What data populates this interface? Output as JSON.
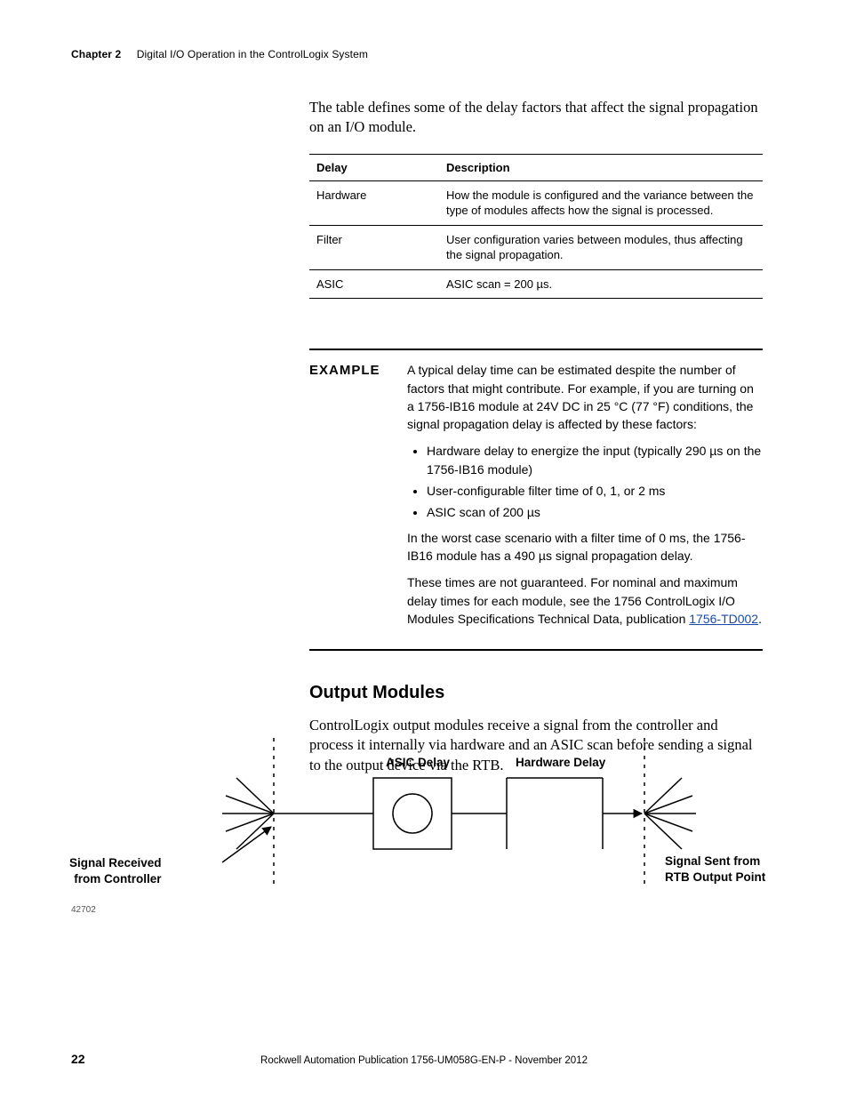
{
  "header": {
    "chapter_label": "Chapter 2",
    "chapter_title": "Digital I/O Operation in the ControlLogix System"
  },
  "intro": "The table defines some of the delay factors that affect the signal propagation on an I/O module.",
  "delay_table": {
    "cols": [
      "Delay",
      "Description"
    ],
    "rows": [
      {
        "delay": "Hardware",
        "desc": "How the module is configured and the variance between the type of modules affects how the signal is processed."
      },
      {
        "delay": "Filter",
        "desc": "User configuration varies between modules, thus affecting the signal propagation."
      },
      {
        "delay": "ASIC",
        "desc": "ASIC scan = 200 µs."
      }
    ]
  },
  "example": {
    "label": "EXAMPLE",
    "p1": "A typical delay time can be estimated despite the number of factors that might contribute. For example, if you are turning on a 1756-IB16 module at 24V DC in 25 °C (77 °F) conditions, the signal propagation delay is affected by these factors:",
    "bullets": [
      "Hardware delay to energize the input (typically 290 µs on the 1756-IB16 module)",
      "User-configurable filter time of 0, 1, or 2 ms",
      "ASIC scan of 200 µs"
    ],
    "p2": "In the worst case scenario with a filter time of 0 ms, the 1756-IB16 module has a 490 µs signal propagation delay.",
    "p3_pre": "These times are not guaranteed. For nominal and maximum delay times for each module, see the 1756 ControlLogix I/O Modules Specifications Technical Data, publication ",
    "p3_link": "1756-TD002",
    "p3_post": "."
  },
  "output_modules": {
    "heading": "Output Modules",
    "p": "ControlLogix output modules receive a signal from the controller and process it internally via hardware and an ASIC scan before sending a signal to the output device via the RTB."
  },
  "diagram": {
    "asic_label": "ASIC Delay",
    "hw_label": "Hardware Delay",
    "left_cap_l1": "Signal Received",
    "left_cap_l2": "from Controller",
    "right_cap_l1": "Signal Sent from",
    "right_cap_l2": "RTB Output Point",
    "fig_num": "42702"
  },
  "footer": {
    "page": "22",
    "pub": "Rockwell Automation Publication 1756-UM058G-EN-P - November 2012"
  }
}
